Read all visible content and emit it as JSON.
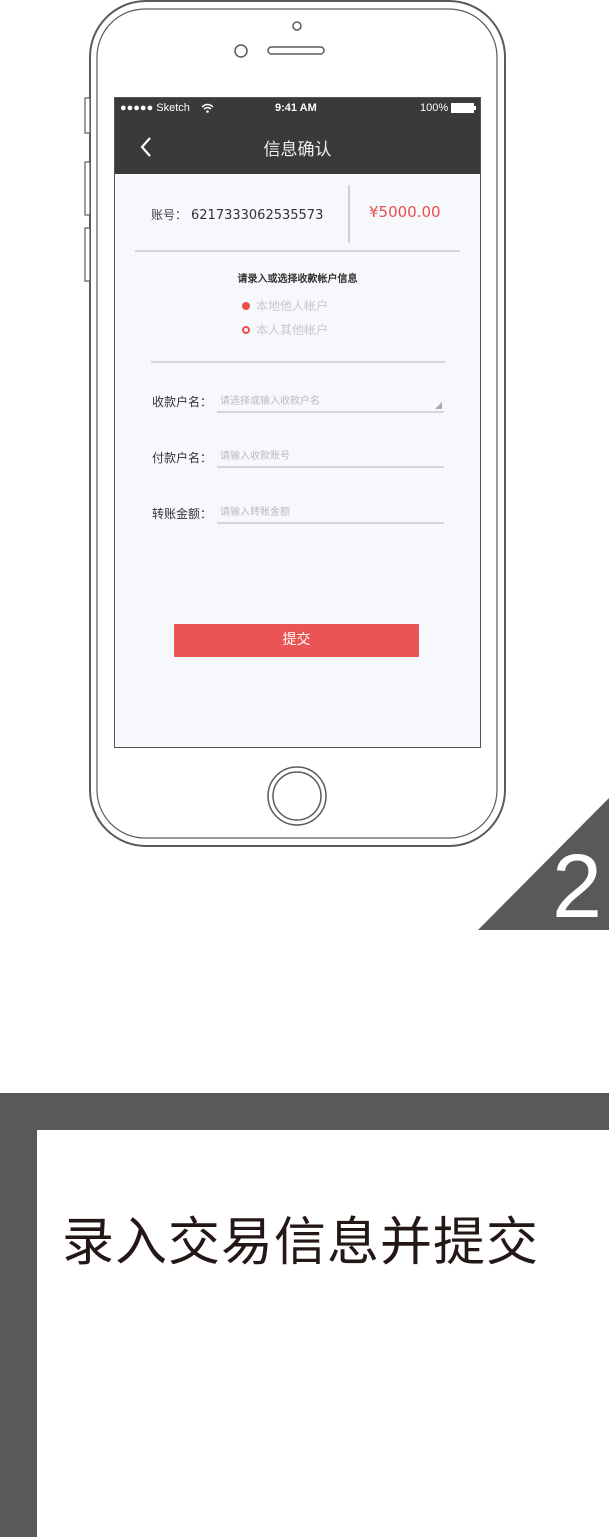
{
  "status_bar": {
    "carrier": "●●●●● Sketch",
    "time": "9:41 AM",
    "battery": "100%"
  },
  "nav": {
    "title": "信息确认",
    "back_icon": "chevron-left-icon"
  },
  "account": {
    "label": "账号：",
    "number": "6217333062535573",
    "amount": "¥5000.00"
  },
  "prompt": "请录入或选择收款帐户信息",
  "options": [
    {
      "label": "本地他人帐户",
      "selected": true
    },
    {
      "label": "本人其他帐户",
      "selected": false
    }
  ],
  "form": {
    "payee_name": {
      "label": "收款户名：",
      "placeholder": "请选择或输入收款户名"
    },
    "payer_name": {
      "label": "付款户名：",
      "placeholder": "请输入收款账号"
    },
    "amount": {
      "label": "转账金额：",
      "placeholder": "请输入转账金额"
    }
  },
  "submit_label": "提交",
  "step_number": "2",
  "caption": "录入交易信息并提交",
  "colors": {
    "accent": "#ea5455",
    "nav_bg": "#3a3a3a",
    "decor_gray": "#58595b"
  }
}
